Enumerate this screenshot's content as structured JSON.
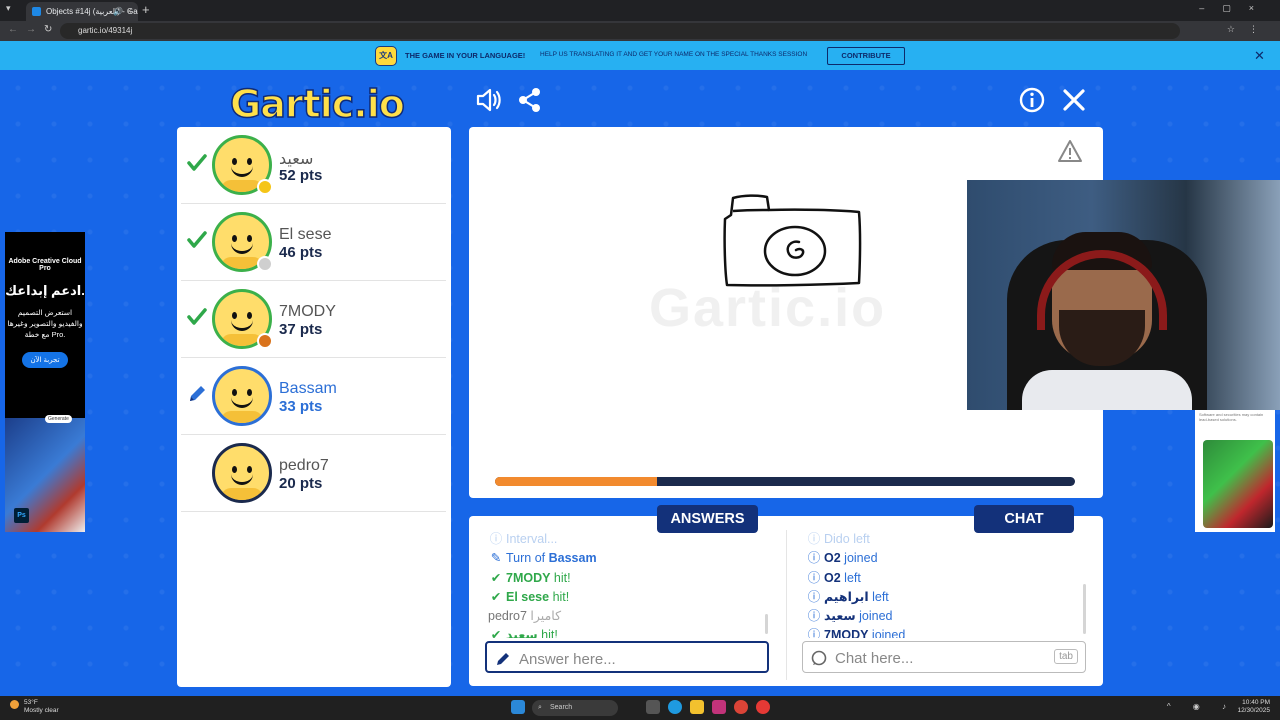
{
  "browser": {
    "tab_title": "Objects #14j (العربية) - Gartic",
    "url": "gartic.io/49314j"
  },
  "banner": {
    "headline": "THE GAME IN YOUR LANGUAGE!",
    "subtext": "HELP US TRANSLATING IT AND GET YOUR NAME ON THE SPECIAL THANKS SESSION",
    "contribute_label": "CONTRIBUTE"
  },
  "game": {
    "logo": "Gartic.io",
    "progress_fraction": 0.28,
    "watermark": "Gartic.io"
  },
  "players": [
    {
      "name": "سعيد",
      "pts": "52 pts",
      "state": "hit",
      "badge_color": "#f5c518"
    },
    {
      "name": "El sese",
      "pts": "46 pts",
      "state": "hit",
      "badge_color": "#cfcfcf"
    },
    {
      "name": "7MODY",
      "pts": "37 pts",
      "state": "hit",
      "badge_color": "#d9731c"
    },
    {
      "name": "Bassam",
      "pts": "33 pts",
      "state": "drawing",
      "badge_color": ""
    },
    {
      "name": "pedro7",
      "pts": "20 pts",
      "state": "none",
      "badge_color": ""
    }
  ],
  "answers": {
    "tab_label": "ANSWERS",
    "lines": [
      {
        "icon": "info",
        "text": "Interval...",
        "style": "fade"
      },
      {
        "icon": "pencil",
        "prefix": "Turn of ",
        "name": "Bassam",
        "suffix": "",
        "style": "turn"
      },
      {
        "icon": "check",
        "name": "7MODY",
        "suffix": " hit!",
        "style": "hit"
      },
      {
        "icon": "check",
        "name": "El sese",
        "suffix": " hit!",
        "style": "hit"
      },
      {
        "icon": "",
        "name": "pedro7",
        "suffix": " كاميرا",
        "style": "guess"
      },
      {
        "icon": "check",
        "name": "سعيد",
        "suffix": " hit!",
        "style": "hit"
      }
    ],
    "input_placeholder": "Answer here..."
  },
  "chat": {
    "tab_label": "CHAT",
    "lines": [
      {
        "name": "Dido",
        "suffix": " left",
        "style": "fade"
      },
      {
        "name": "O2",
        "suffix": " joined",
        "style": "event"
      },
      {
        "name": "O2",
        "suffix": " left",
        "style": "event"
      },
      {
        "name": "ابراهيم",
        "suffix": " left",
        "style": "event"
      },
      {
        "name": "سعيد",
        "suffix": " joined",
        "style": "event"
      },
      {
        "name": "7MODY",
        "suffix": " joined",
        "style": "event"
      }
    ],
    "input_placeholder": "Chat here...",
    "tab_key": "tab"
  },
  "ads": {
    "left_brand": "Adobe Creative Cloud Pro",
    "left_title": "ادعم إبداعك.",
    "left_desc": "استعرض التصميم والفيديو والتصوير وغيرها مع خطة Pro.",
    "left_button": "تجربة الآن",
    "left_generate": "Generate",
    "left_ps": "Ps",
    "right_small": "Software and securities may contain lead-based solutions."
  },
  "taskbar": {
    "temp": "53°F",
    "weather": "Mostly clear",
    "search": "Search",
    "time": "10:40 PM",
    "date": "12/30/2025"
  },
  "colors": {
    "background": "#1766e8",
    "banner": "#27b0f2",
    "navy": "#13317a",
    "hit_green": "#2fa84a",
    "accent_blue": "#2c6fd6",
    "progress_fill": "#f28a2e"
  }
}
